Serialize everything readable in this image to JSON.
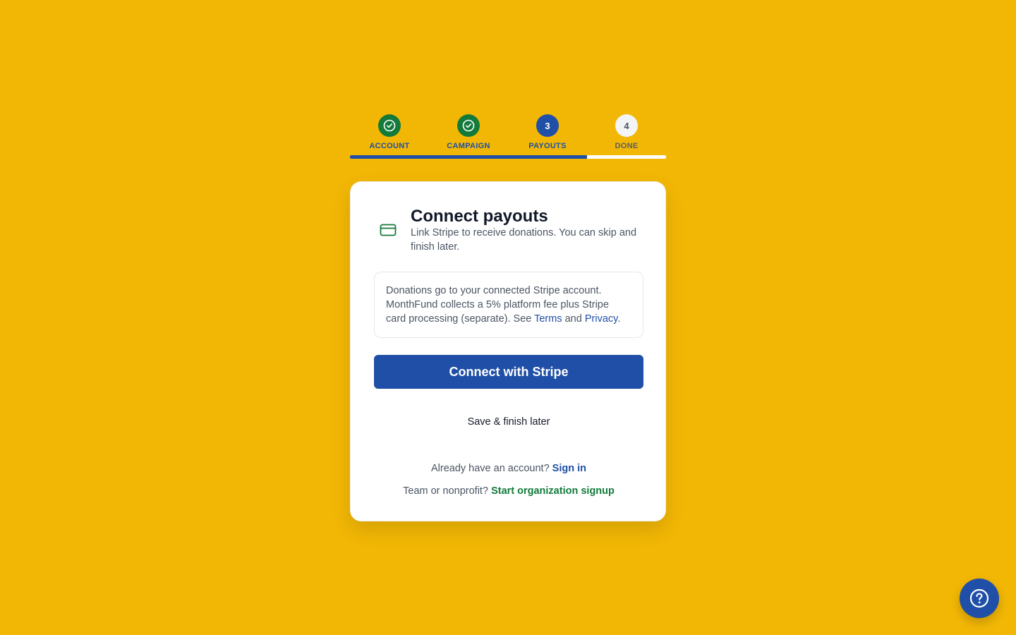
{
  "stepper": {
    "steps": [
      {
        "label": "ACCOUNT",
        "state": "complete",
        "icon": "check-icon"
      },
      {
        "label": "CAMPAIGN",
        "state": "complete",
        "icon": "check-icon"
      },
      {
        "label": "PAYOUTS",
        "state": "current",
        "number": "3"
      },
      {
        "label": "DONE",
        "state": "todo",
        "number": "4"
      }
    ],
    "progress_fraction": 0.75
  },
  "card": {
    "icon": "credit-card-icon",
    "title": "Connect payouts",
    "subtitle": "Link Stripe to receive donations. You can skip and finish later.",
    "info": {
      "text_before": "Donations go to your connected Stripe account. MonthFund collects a 5% platform fee plus Stripe card processing (separate). See ",
      "terms_link": "Terms",
      "and": " and ",
      "privacy_link": "Privacy",
      "period": "."
    },
    "primary_button": "Connect with Stripe",
    "secondary_button": "Save & finish later",
    "signin_prompt": "Already have an account? ",
    "signin_link": "Sign in",
    "org_prompt": "Team or nonprofit? ",
    "org_link": "Start organization signup"
  },
  "help": {
    "icon": "help-circle-icon"
  },
  "colors": {
    "background": "#F2B705",
    "primary": "#1F4FA6",
    "success": "#127A3A"
  }
}
